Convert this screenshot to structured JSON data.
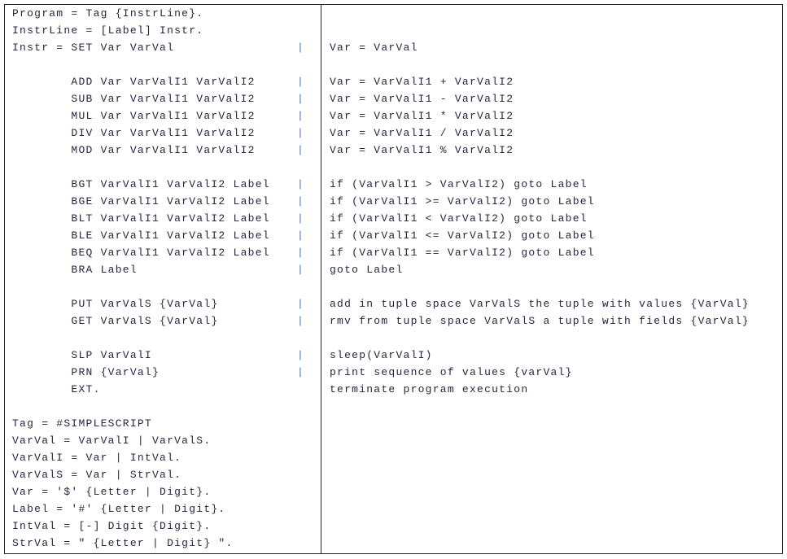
{
  "rows": [
    {
      "left": "Program = Tag {InstrLine}.",
      "pipe": false,
      "right": ""
    },
    {
      "left": "InstrLine = [Label] Instr.",
      "pipe": false,
      "right": ""
    },
    {
      "left": "Instr = SET Var VarVal",
      "pipe": true,
      "right": "Var = VarVal"
    },
    {
      "left": "",
      "pipe": false,
      "right": ""
    },
    {
      "left": "        ADD Var VarValI1 VarValI2",
      "pipe": true,
      "right": "Var = VarValI1 + VarValI2"
    },
    {
      "left": "        SUB Var VarValI1 VarValI2",
      "pipe": true,
      "right": "Var = VarValI1 - VarValI2"
    },
    {
      "left": "        MUL Var VarValI1 VarValI2",
      "pipe": true,
      "right": "Var = VarValI1 * VarValI2"
    },
    {
      "left": "        DIV Var VarValI1 VarValI2",
      "pipe": true,
      "right": "Var = VarValI1 / VarValI2"
    },
    {
      "left": "        MOD Var VarValI1 VarValI2",
      "pipe": true,
      "right": "Var = VarValI1 % VarValI2"
    },
    {
      "left": "",
      "pipe": false,
      "right": ""
    },
    {
      "left": "        BGT VarValI1 VarValI2 Label",
      "pipe": true,
      "right": "if (VarValI1 > VarValI2) goto Label"
    },
    {
      "left": "        BGE VarValI1 VarValI2 Label",
      "pipe": true,
      "right": "if (VarValI1 >= VarValI2) goto Label"
    },
    {
      "left": "        BLT VarValI1 VarValI2 Label",
      "pipe": true,
      "right": "if (VarValI1 < VarValI2) goto Label"
    },
    {
      "left": "        BLE VarValI1 VarValI2 Label",
      "pipe": true,
      "right": "if (VarValI1 <= VarValI2) goto Label"
    },
    {
      "left": "        BEQ VarValI1 VarValI2 Label",
      "pipe": true,
      "right": "if (VarValI1 == VarValI2) goto Label"
    },
    {
      "left": "        BRA Label",
      "pipe": true,
      "right": "goto Label"
    },
    {
      "left": "",
      "pipe": false,
      "right": ""
    },
    {
      "left": "        PUT VarValS {VarVal}",
      "pipe": true,
      "right": "add in tuple space VarValS the tuple with values {VarVal}"
    },
    {
      "left": "        GET VarValS {VarVal}",
      "pipe": true,
      "right": "rmv from tuple space VarValS a tuple with fields {VarVal}"
    },
    {
      "left": "",
      "pipe": false,
      "right": ""
    },
    {
      "left": "        SLP VarValI",
      "pipe": true,
      "right": "sleep(VarValI)"
    },
    {
      "left": "        PRN {VarVal}",
      "pipe": true,
      "right": "print sequence of values {varVal}"
    },
    {
      "left": "        EXT.",
      "pipe": false,
      "right": "terminate program execution"
    },
    {
      "left": "",
      "pipe": false,
      "right": ""
    },
    {
      "left": "Tag = #SIMPLESCRIPT",
      "pipe": false,
      "right": ""
    },
    {
      "left": "VarVal = VarValI | VarValS.",
      "pipe": false,
      "right": ""
    },
    {
      "left": "VarValI = Var | IntVal.",
      "pipe": false,
      "right": ""
    },
    {
      "left": "VarValS = Var | StrVal.",
      "pipe": false,
      "right": ""
    },
    {
      "left": "Var = '$' {Letter | Digit}.",
      "pipe": false,
      "right": ""
    },
    {
      "left": "Label = '#' {Letter | Digit}.",
      "pipe": false,
      "right": ""
    },
    {
      "left": "IntVal = [-] Digit {Digit}.",
      "pipe": false,
      "right": ""
    },
    {
      "left": "StrVal = \" {Letter | Digit} \".",
      "pipe": false,
      "right": ""
    }
  ],
  "pipe_symbol": "|",
  "colors": {
    "text": "#2a2440",
    "pipe": "#4a6fc4",
    "border": "#222222"
  }
}
